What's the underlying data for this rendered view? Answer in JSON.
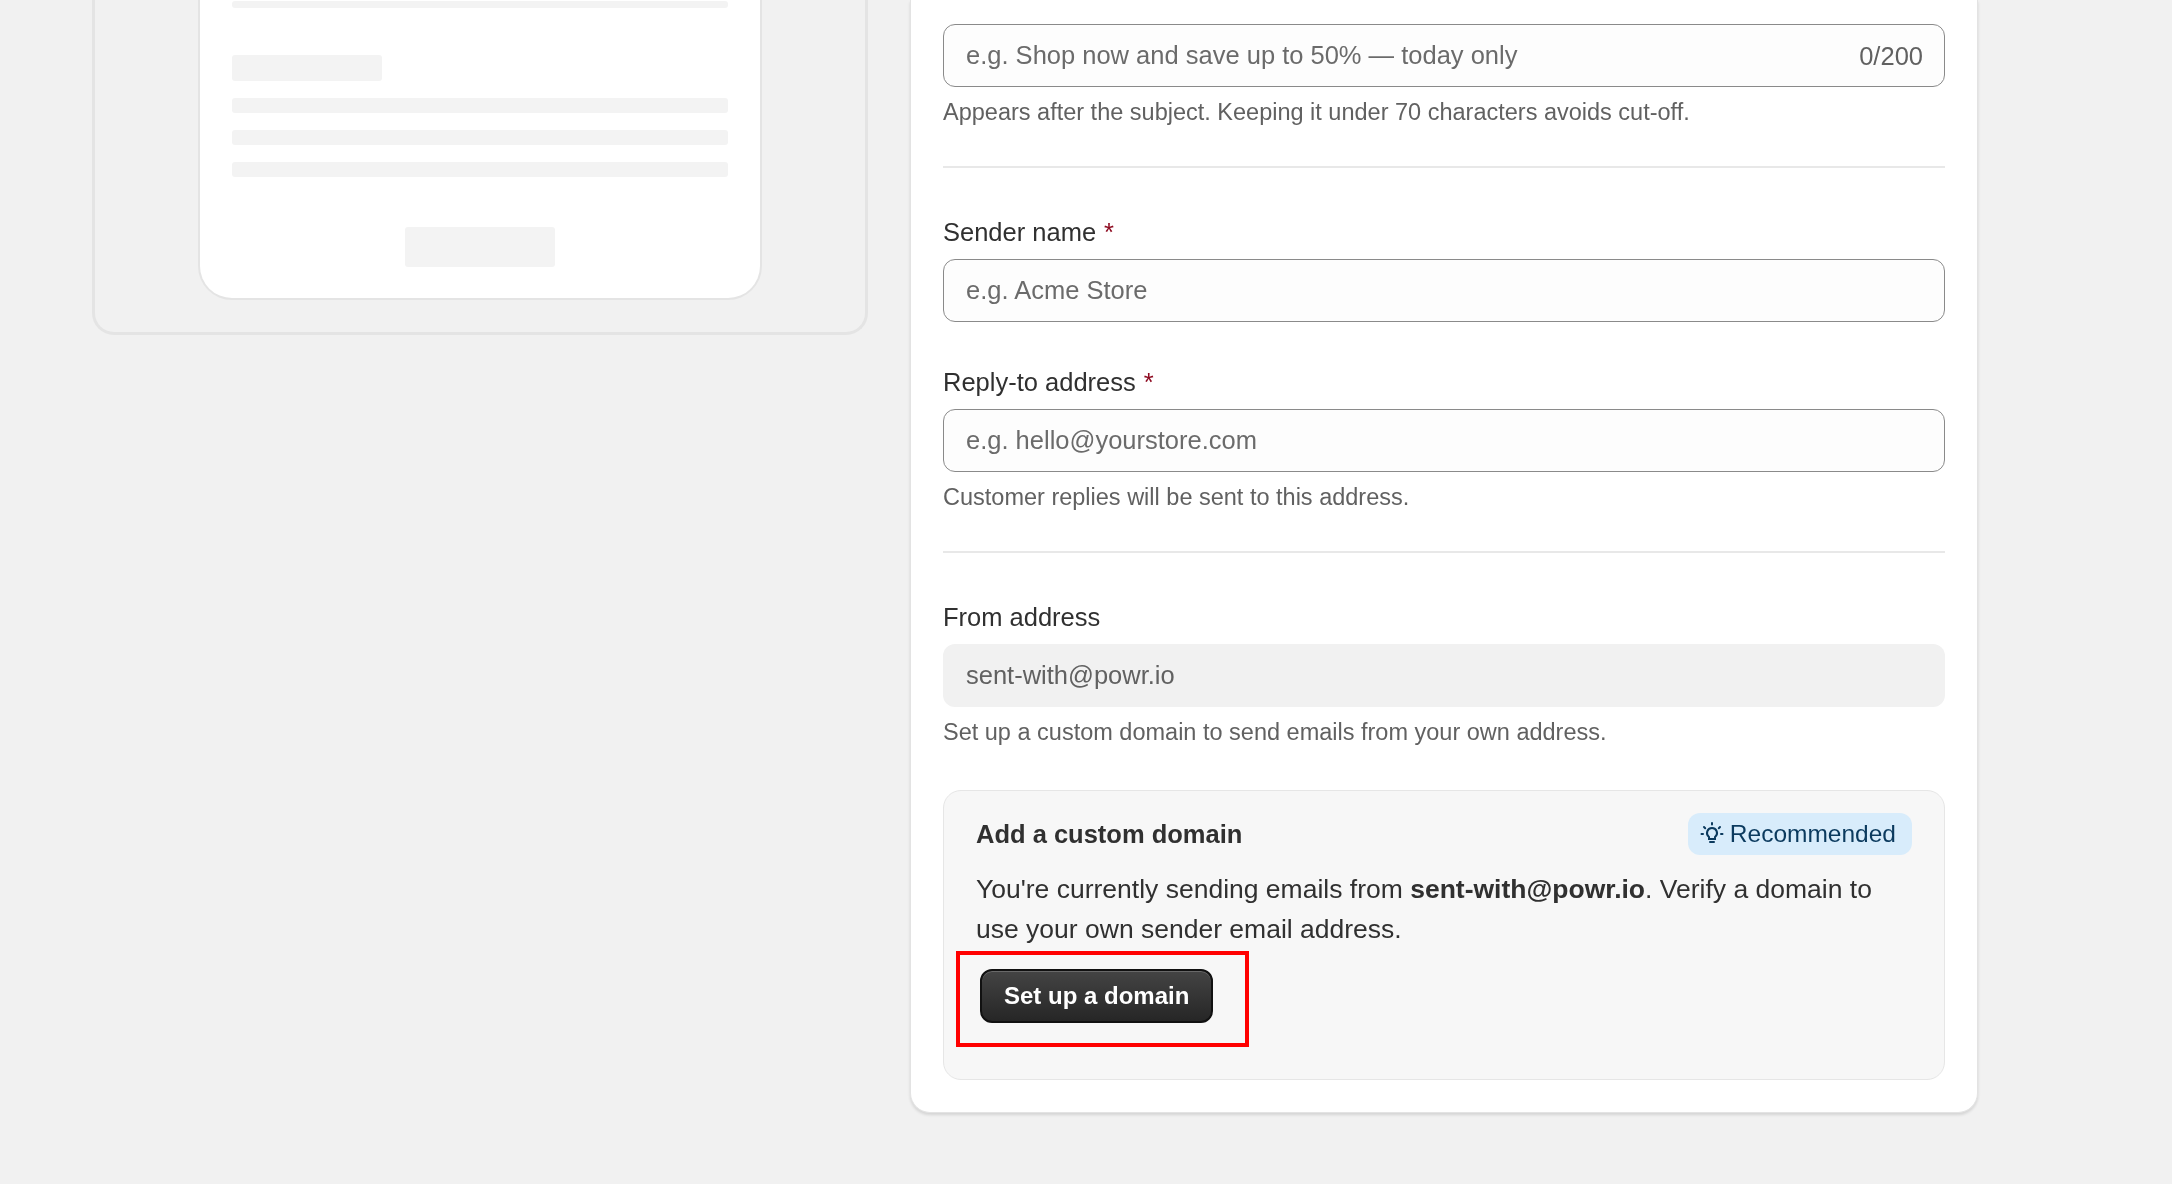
{
  "preview_text_field": {
    "placeholder": "e.g. Shop now and save up to 50% — today only",
    "counter": "0/200",
    "hint": "Appears after the subject. Keeping it under 70 characters avoids cut-off."
  },
  "sender_fields": [
    {
      "label": "Sender name",
      "required_mark": "*",
      "placeholder": "e.g. Acme Store"
    },
    {
      "label": "Reply-to address",
      "required_mark": "*",
      "placeholder": "e.g. hello@yourstore.com",
      "hint": "Customer replies will be sent to this address."
    }
  ],
  "from_address": {
    "label": "From address",
    "value": "sent-with@powr.io",
    "disabled": true,
    "hint": "Set up a custom domain to send emails from your own address."
  },
  "custom_domain": {
    "title": "Add a custom domain",
    "badge": "Recommended",
    "text": "You're currently sending emails from **sent-with@powr.io**. Verify a domain to use your own sender email address.",
    "button": "Set up a domain",
    "highlighted": true
  }
}
